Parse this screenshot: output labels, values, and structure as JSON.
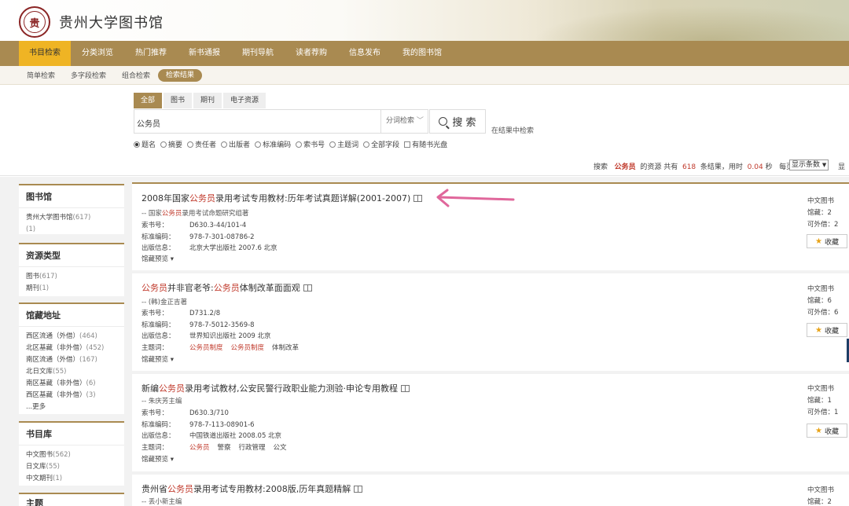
{
  "header": {
    "logo_text": "贵",
    "site_title": "贵州大学图书馆"
  },
  "main_nav": [
    "书目检索",
    "分类浏览",
    "热门推荐",
    "新书通报",
    "期刊导航",
    "读者荐购",
    "信息发布",
    "我的图书馆"
  ],
  "sub_nav": [
    "简单检索",
    "多字段检索",
    "组合检索",
    "检索结果"
  ],
  "search": {
    "tabs": [
      "全部",
      "图书",
      "期刊",
      "电子资源"
    ],
    "value": "公务员",
    "mode": "分词检索",
    "button": "搜 索",
    "within_label": "在结果中检索",
    "fields": [
      "题名",
      "摘要",
      "责任者",
      "出版者",
      "标准编码",
      "索书号",
      "主题词",
      "全部字段"
    ],
    "checkbox": "有随书光盘"
  },
  "result_info": {
    "prefix": "搜索",
    "keyword": "公务员",
    "middle": "的资源 共有",
    "count": "618",
    "suffix": "条结果，用时",
    "time": "0.04",
    "time_unit": "秒",
    "per_page_label": "每页显示：",
    "per_page_value": "显示条数",
    "cut": "显"
  },
  "sidebar": [
    {
      "heading": "图书馆",
      "items": [
        {
          "text": "贵州大学图书馆",
          "count": "(617)"
        },
        {
          "text": "",
          "count": "(1)"
        }
      ]
    },
    {
      "heading": "资源类型",
      "items": [
        {
          "text": "图书",
          "count": "(617)"
        },
        {
          "text": "期刊",
          "count": "(1)"
        }
      ]
    },
    {
      "heading": "馆藏地址",
      "items": [
        {
          "text": "西区流通（外借）",
          "count": "(464)"
        },
        {
          "text": "北区基藏（非外借）",
          "count": "(452)"
        },
        {
          "text": "南区流通（外借）",
          "count": "(167)"
        },
        {
          "text": "北日文库",
          "count": "(55)"
        },
        {
          "text": "南区基藏（非外借）",
          "count": "(6)"
        },
        {
          "text": "西区基藏（非外借）",
          "count": "(3)"
        },
        {
          "text": "...更多",
          "count": ""
        }
      ]
    },
    {
      "heading": "书目库",
      "items": [
        {
          "text": "中文图书",
          "count": "(562)"
        },
        {
          "text": "日文库",
          "count": "(55)"
        },
        {
          "text": "中文期刊",
          "count": "(1)"
        }
      ]
    },
    {
      "heading": "主题",
      "items": []
    }
  ],
  "results": [
    {
      "title_pre": "2008年国家",
      "title_hl": "公务员",
      "title_post": "录用考试专用教材:历年考试真题详解(2001-2007)",
      "author_pre": "-- 国家",
      "author_hl": "公务员",
      "author_post": "录用考试命题研究组著",
      "call_label": "索书号：",
      "call_no": "D630.3-44/101-4",
      "isbn_label": "标准编码：",
      "isbn": "978-7-301-08786-2",
      "pub_label": "出版信息：",
      "pub": "北京大学出版社  2007.6  北京",
      "subject_label": "",
      "subjects": [],
      "preview": "馆藏预览 ▾",
      "type": "中文图书",
      "holdings": "馆藏：2",
      "lendable": "可外借：2",
      "fav": "收藏"
    },
    {
      "title_pre": "",
      "title_hl": "公务员",
      "title_post": "并非官老爷:",
      "title_hl2": "公务员",
      "title_post2": "体制改革面面观",
      "author_pre": "-- (韩)金正吉著",
      "author_hl": "",
      "author_post": "",
      "call_label": "索书号：",
      "call_no": "D731.2/8",
      "isbn_label": "标准编码：",
      "isbn": "978-7-5012-3569-8",
      "pub_label": "出版信息：",
      "pub": "世界知识出版社  2009  北京",
      "subject_label": "主题词：",
      "subjects": [
        "公务员制度",
        "公务员制度",
        "体制改革"
      ],
      "preview": "馆藏预览 ▾",
      "type": "中文图书",
      "holdings": "馆藏：6",
      "lendable": "可外借：6",
      "fav": "收藏"
    },
    {
      "title_pre": "新编",
      "title_hl": "公务员",
      "title_post": "录用考试教材,公安民警行政职业能力测验·申论专用教程",
      "author_pre": "-- 朱庆芳主编",
      "author_hl": "",
      "author_post": "",
      "call_label": "索书号：",
      "call_no": "D630.3/710",
      "isbn_label": "标准编码：",
      "isbn": "978-7-113-08901-6",
      "pub_label": "出版信息：",
      "pub": "中国铁道出版社  2008.05  北京",
      "subject_label": "主题词：",
      "subjects": [
        "公务员",
        "警察",
        "行政管理",
        "公文"
      ],
      "preview": "馆藏预览 ▾",
      "type": "中文图书",
      "holdings": "馆藏：1",
      "lendable": "可外借：1",
      "fav": "收藏"
    },
    {
      "title_pre": "贵州省",
      "title_hl": "公务员",
      "title_post": "录用考试专用教材:2008版,历年真题精解",
      "author_pre": "-- 丢小新主编",
      "author_hl": "",
      "author_post": "",
      "type": "中文图书",
      "holdings": "馆藏：2"
    }
  ],
  "colors": {
    "brand": "#a98a51",
    "active_tab": "#efb424",
    "highlight": "#c0392b",
    "annotation_arrow": "#e0679b"
  }
}
